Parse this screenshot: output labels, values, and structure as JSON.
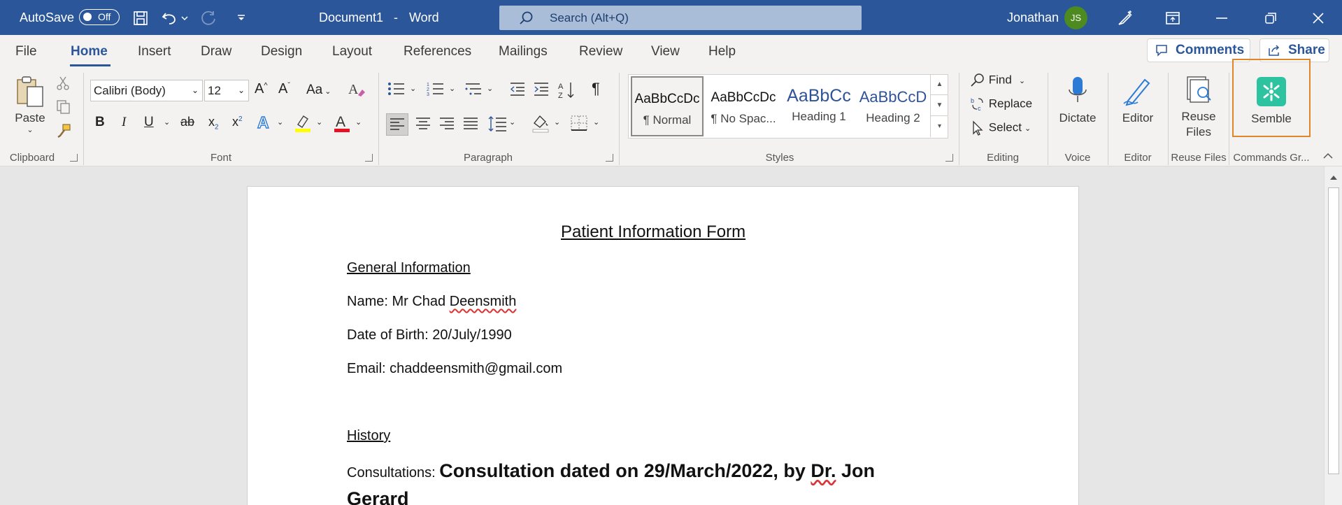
{
  "titlebar": {
    "autosave_label": "AutoSave",
    "autosave_state": "Off",
    "doc_title": "Document1",
    "separator": "-",
    "app_name": "Word",
    "search_placeholder": "Search (Alt+Q)",
    "user_name": "Jonathan",
    "user_initials": "JS"
  },
  "tabs": [
    "File",
    "Home",
    "Insert",
    "Draw",
    "Design",
    "Layout",
    "References",
    "Mailings",
    "Review",
    "View",
    "Help"
  ],
  "header_buttons": {
    "comments": "Comments",
    "share": "Share"
  },
  "clipboard": {
    "paste": "Paste",
    "group": "Clipboard"
  },
  "font": {
    "family": "Calibri (Body)",
    "size": "12",
    "case": "Aa",
    "group": "Font"
  },
  "paragraph": {
    "group": "Paragraph"
  },
  "styles": {
    "group": "Styles",
    "items": [
      {
        "preview": "AaBbCcDc",
        "name": "¶ Normal"
      },
      {
        "preview": "AaBbCcDc",
        "name": "¶ No Spac..."
      },
      {
        "preview": "AaBbCc",
        "name": "Heading 1"
      },
      {
        "preview": "AaBbCcD",
        "name": "Heading 2"
      }
    ]
  },
  "editing": {
    "find": "Find",
    "replace": "Replace",
    "select": "Select",
    "group": "Editing"
  },
  "voice": {
    "dictate": "Dictate",
    "group": "Voice"
  },
  "editor": {
    "button": "Editor",
    "group": "Editor"
  },
  "reuse": {
    "line1": "Reuse",
    "line2": "Files",
    "group": "Reuse Files"
  },
  "commands": {
    "semble": "Semble",
    "group": "Commands Gr..."
  },
  "document": {
    "title": "Patient Information Form",
    "general_heading": "General Information",
    "name_label": "Name: Mr Chad ",
    "name_last": "Deensmith",
    "dob": "Date of Birth: 20/July/1990",
    "email": "Email: chaddeensmith@gmail.com",
    "history_heading": "History",
    "consult_label": "Consultations: ",
    "consult_text_a": "Consultation dated on 29/March/2022, by ",
    "consult_text_dr": "Dr.",
    "consult_text_b": " Jon",
    "consult_text_c": "Gerard"
  },
  "colors": {
    "word_blue": "#2b579a",
    "highlight_orange": "#e0852a",
    "semble_green": "#2ec3a0",
    "avatar_green": "#4d8a1f"
  }
}
